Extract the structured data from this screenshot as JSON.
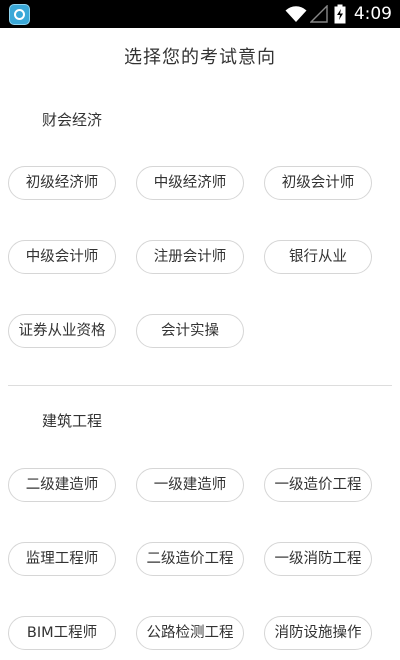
{
  "status_bar": {
    "time": "4:09",
    "icons": [
      "app-icon",
      "wifi-icon",
      "signal-icon",
      "battery-charging-icon"
    ]
  },
  "header": {
    "title": "选择您的考试意向"
  },
  "sections": [
    {
      "title": "财会经济",
      "options": [
        "初级经济师",
        "中级经济师",
        "初级会计师",
        "中级会计师",
        "注册会计师",
        "银行从业",
        "证券从业资格",
        "会计实操"
      ]
    },
    {
      "title": "建筑工程",
      "options": [
        "二级建造师",
        "一级建造师",
        "一级造价工程",
        "监理工程师",
        "二级造价工程",
        "一级消防工程",
        "BIM工程师",
        "公路检测工程",
        "消防设施操作"
      ]
    }
  ],
  "colors": {
    "chip_border": "#d6d6d6",
    "text": "#333333",
    "status_bar": "#000000",
    "divider": "#dddddd"
  }
}
